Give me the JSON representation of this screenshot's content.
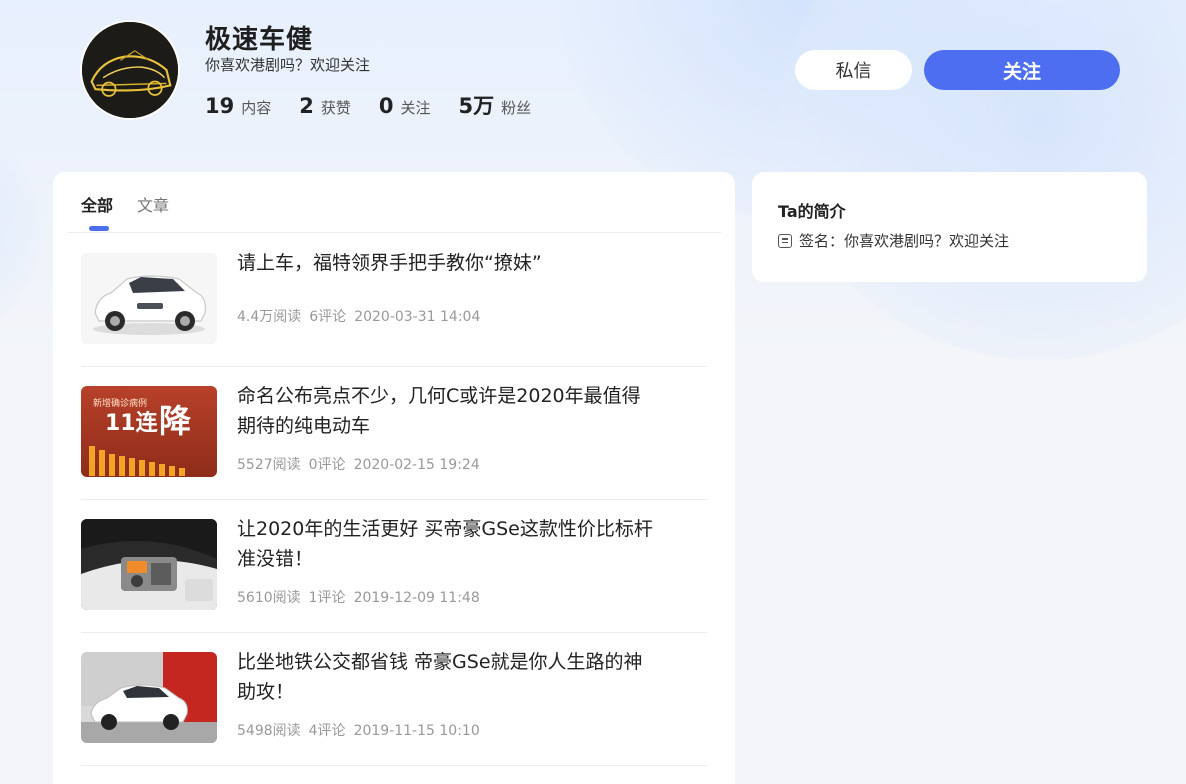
{
  "profile": {
    "name": "极速车健",
    "bio": "你喜欢港剧吗？欢迎关注",
    "stats": [
      {
        "value": "19",
        "label": "内容"
      },
      {
        "value": "2",
        "label": "获赞"
      },
      {
        "value": "0",
        "label": "关注"
      },
      {
        "value": "5万",
        "label": "粉丝"
      }
    ]
  },
  "actions": {
    "message_label": "私信",
    "follow_label": "关注"
  },
  "tabs": [
    {
      "label": "全部",
      "active": true
    },
    {
      "label": "文章",
      "active": false
    }
  ],
  "articles": [
    {
      "title": "请上车，福特领界手把手教你“撩妹”",
      "reads": "4.4万阅读",
      "comments": "6评论",
      "date": "2020-03-31 14:04",
      "thumb_icon": "white-suv-image"
    },
    {
      "title": "命名公布亮点不少，几何C或许是2020年最值得期待的纯电动车",
      "reads": "5527阅读",
      "comments": "0评论",
      "date": "2020-02-15 19:24",
      "thumb_icon": "infographic-image",
      "thumb_text_top": "新增确诊病例",
      "thumb_text_big": "11连",
      "thumb_text_char": "降"
    },
    {
      "title": "让2020年的生活更好 买帝豪GSe这款性价比标杆准没错！",
      "reads": "5610阅读",
      "comments": "1评论",
      "date": "2019-12-09 11:48",
      "thumb_icon": "engine-bay-image"
    },
    {
      "title": "比坐地铁公交都省钱 帝豪GSe就是你人生路的神助攻！",
      "reads": "5498阅读",
      "comments": "4评论",
      "date": "2019-11-15 10:10",
      "thumb_icon": "white-ev-image"
    }
  ],
  "sidebar": {
    "title": "Ta的简介",
    "signature": "签名：你喜欢港剧吗？欢迎关注"
  },
  "colors": {
    "accent": "#4e6ef2",
    "background": "#f3f5f9"
  }
}
